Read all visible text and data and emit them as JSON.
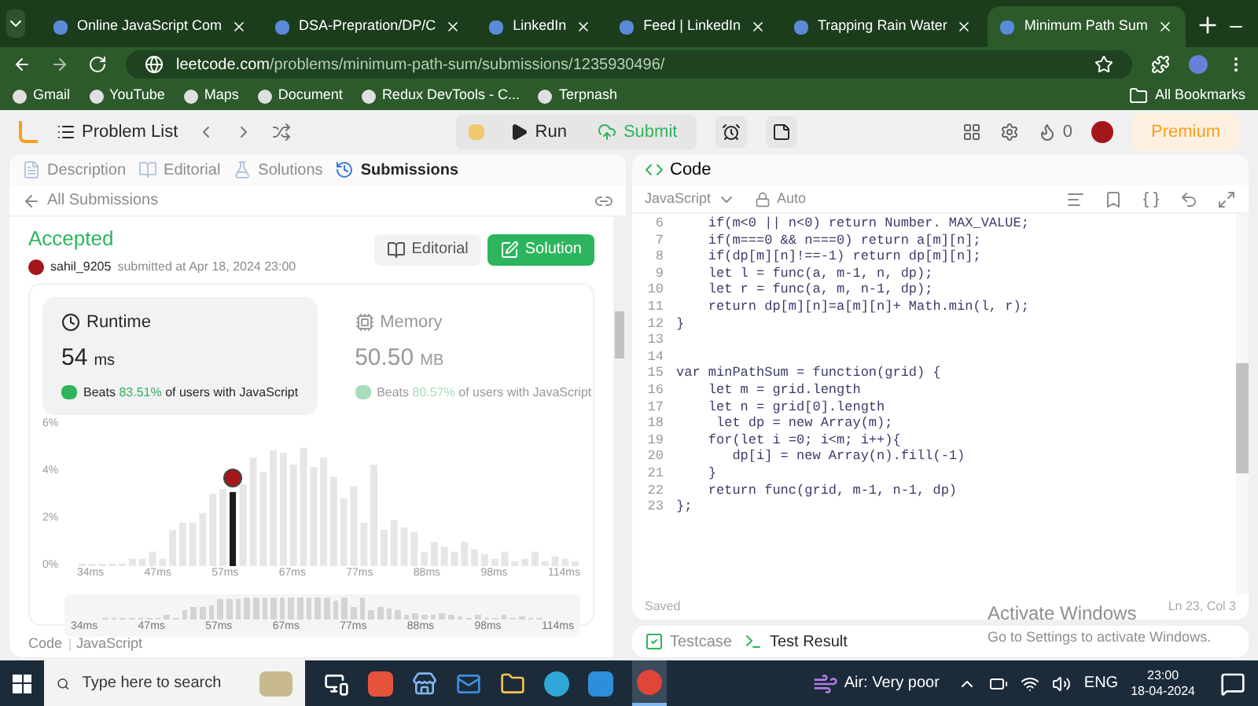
{
  "browser": {
    "tabs": [
      {
        "title": "Online JavaScript Com",
        "selected": false
      },
      {
        "title": "DSA-Prepration/DP/C",
        "selected": false
      },
      {
        "title": "LinkedIn",
        "selected": false
      },
      {
        "title": "Feed | LinkedIn",
        "selected": false
      },
      {
        "title": "Trapping Rain Water",
        "selected": false
      },
      {
        "title": "Minimum Path Sum",
        "selected": true
      }
    ],
    "url_host": "leetcode.com",
    "url_path": "/problems/minimum-path-sum/submissions/1235930496/",
    "bookmarks": [
      "Gmail",
      "YouTube",
      "Maps",
      "Document",
      "Redux DevTools - C...",
      "Terpnash"
    ],
    "all_bookmarks": "All Bookmarks"
  },
  "nav": {
    "problem_list": "Problem List",
    "run": "Run",
    "submit": "Submit",
    "streak": "0",
    "premium": "Premium"
  },
  "left_panel": {
    "tabs": [
      {
        "label": "Description",
        "selected": false
      },
      {
        "label": "Editorial",
        "selected": false
      },
      {
        "label": "Solutions",
        "selected": false
      },
      {
        "label": "Submissions",
        "selected": true
      }
    ],
    "back_link": "All Submissions",
    "status": "Accepted",
    "user": "sahil_9205",
    "submitted": "submitted at Apr 18, 2024 23:00",
    "editorial_button": "Editorial",
    "solution_button": "Solution",
    "runtime": {
      "title": "Runtime",
      "value": "54",
      "unit": "ms",
      "beats_prefix": "Beats",
      "beats_pct": "83.51%",
      "beats_suffix": "of users with JavaScript",
      "selected": true
    },
    "memory": {
      "title": "Memory",
      "value": "50.50",
      "unit": "MB",
      "beats_prefix": "Beats",
      "beats_pct": "80.57%",
      "beats_suffix": "of users with JavaScript",
      "selected": false
    },
    "y_axis_labels": [
      "6%",
      "4%",
      "2%",
      "0%"
    ],
    "x_axis_labels": [
      "34ms",
      "47ms",
      "57ms",
      "67ms",
      "77ms",
      "88ms",
      "98ms",
      "114ms"
    ],
    "overview_labels": [
      "34ms",
      "47ms",
      "57ms",
      "67ms",
      "77ms",
      "88ms",
      "98ms",
      "114ms"
    ],
    "code_label": "Code",
    "code_language": "JavaScript"
  },
  "editor": {
    "title": "Code",
    "language": "JavaScript",
    "mode": "Auto",
    "lines": [
      {
        "n": "6",
        "text": "    if(m<0 || n<0) return Number. MAX_VALUE;"
      },
      {
        "n": "7",
        "text": "    if(m===0 && n===0) return a[m][n];"
      },
      {
        "n": "8",
        "text": "    if(dp[m][n]!==-1) return dp[m][n];"
      },
      {
        "n": "9",
        "text": "    let l = func(a, m-1, n, dp);"
      },
      {
        "n": "10",
        "text": "    let r = func(a, m, n-1, dp);"
      },
      {
        "n": "11",
        "text": "    return dp[m][n]=a[m][n]+ Math.min(l, r);"
      },
      {
        "n": "12",
        "text": "}"
      },
      {
        "n": "13"
      },
      {
        "n": "14"
      },
      {
        "n": "15",
        "text": "var minPathSum = function(grid) {"
      },
      {
        "n": "16",
        "text": "    let m = grid.length"
      },
      {
        "n": "17",
        "text": "    let n = grid[0].length"
      },
      {
        "n": "18",
        "text": "     let dp = new Array(m);"
      },
      {
        "n": "19",
        "text": "    for(let i =0; i<m; i++){"
      },
      {
        "n": "20",
        "text": "       dp[i] = new Array(n).fill(-1)"
      },
      {
        "n": "21",
        "text": "    }"
      },
      {
        "n": "22",
        "text": "    return func(grid, m-1, n-1, dp)"
      },
      {
        "n": "23",
        "text": "};"
      }
    ],
    "saved": "Saved",
    "cursor": "Ln 23, Col 3"
  },
  "bottom_tabs": [
    {
      "label": "Testcase",
      "selected": false
    },
    {
      "label": "Test Result",
      "selected": true
    }
  ],
  "activation": {
    "title": "Activate Windows",
    "subtitle": "Go to Settings to activate Windows."
  },
  "taskbar": {
    "search_placeholder": "Type here to search",
    "air": "Air: Very poor",
    "lang": "ENG",
    "time": "23:00",
    "date": "18-04-2024"
  }
}
